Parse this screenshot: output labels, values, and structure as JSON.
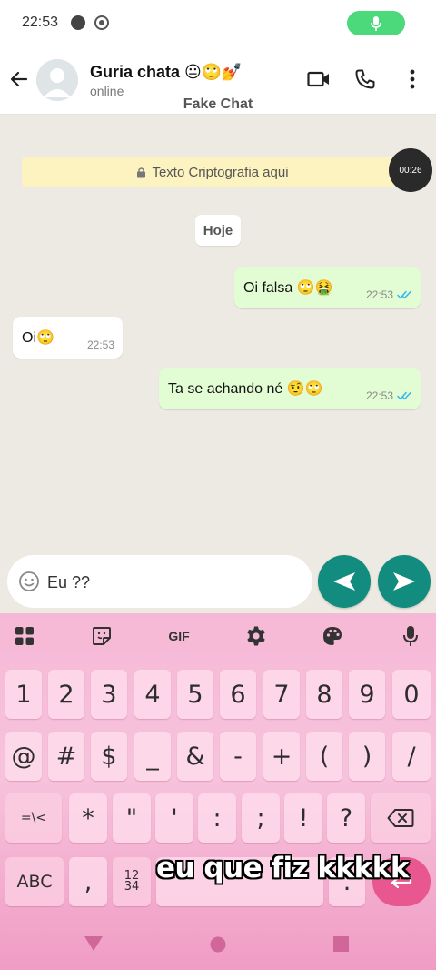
{
  "status_bar": {
    "time": "22:53"
  },
  "header": {
    "contact_name": "Guria chata 😐🙄💅",
    "contact_status": "online",
    "subtitle": "Fake Chat"
  },
  "chat": {
    "encryption_notice": "Texto Criptografia aqui",
    "timer": "00:26",
    "date_chip": "Hoje",
    "messages": [
      {
        "direction": "outgoing",
        "text": "Oi falsa 🙄🤮",
        "time": "22:53",
        "ticks": "read"
      },
      {
        "direction": "incoming",
        "text": "Oi🙄",
        "time": "22:53"
      },
      {
        "direction": "outgoing",
        "text": "Ta se achando né 🤨🙄",
        "time": "22:53",
        "ticks": "read"
      }
    ]
  },
  "composer": {
    "input_value": "Eu ??"
  },
  "keyboard": {
    "toolbar": {
      "gif": "GIF"
    },
    "row_numbers": [
      "1",
      "2",
      "3",
      "4",
      "5",
      "6",
      "7",
      "8",
      "9",
      "0"
    ],
    "row_symbols_1": [
      "@",
      "#",
      "$",
      "_",
      "&",
      "-",
      "+",
      "(",
      ")",
      "/"
    ],
    "row_symbols_2": [
      "=\\<",
      "*",
      "\"",
      "'",
      ":",
      ";",
      "!",
      "?"
    ],
    "abc_label": "ABC",
    "comma": ",",
    "numpad_label": "12\n34",
    "period": ".",
    "overlay_caption": "eu que fiz kkkkk"
  },
  "colors": {
    "accent_green": "#128c7e",
    "outgoing_bubble": "#e2fcd3",
    "read_tick": "#34b7f1",
    "keyboard_pink": "#f6b8d6"
  }
}
